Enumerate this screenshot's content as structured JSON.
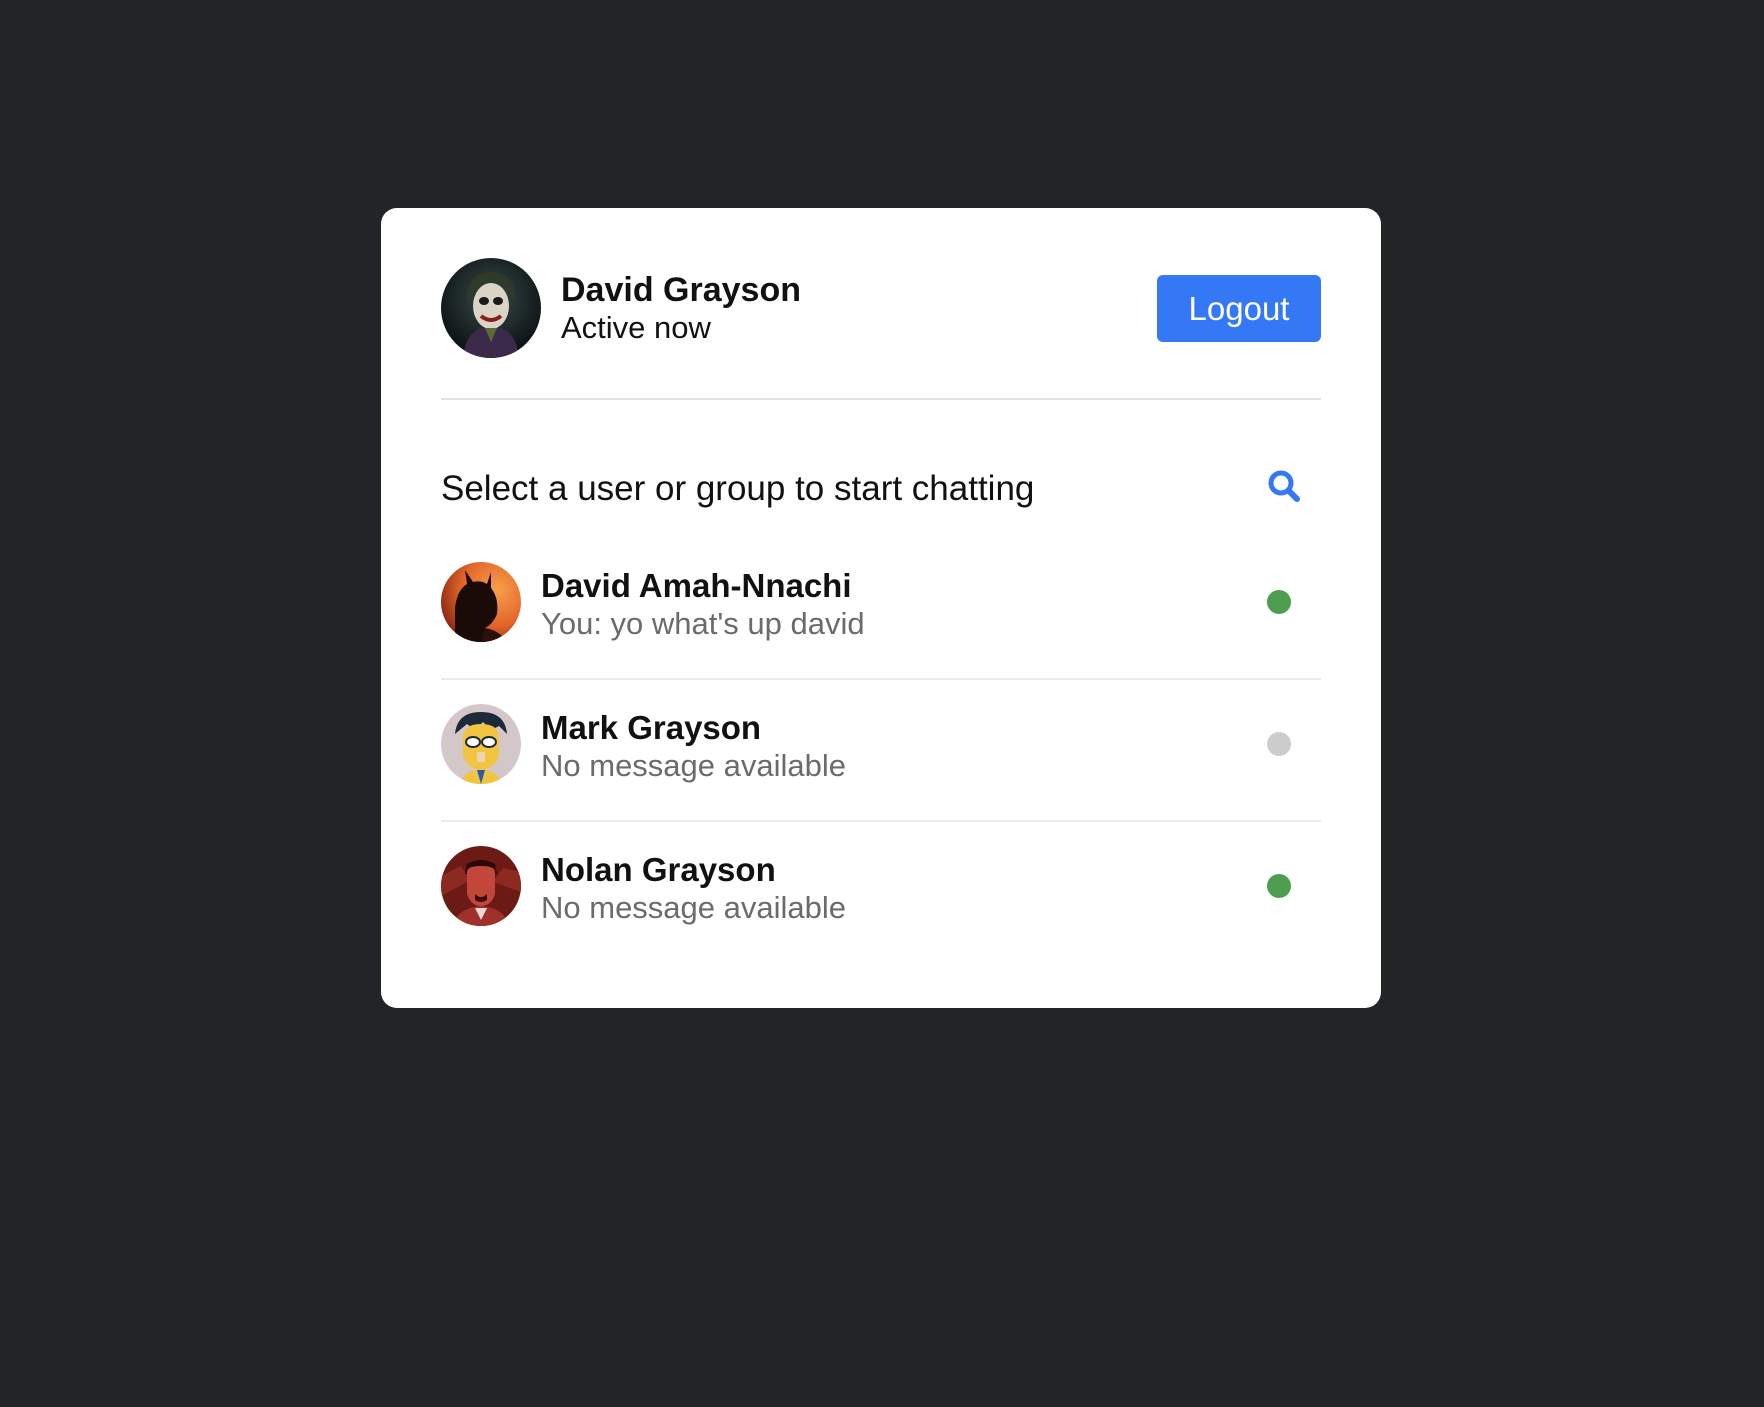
{
  "current_user": {
    "name": "David Grayson",
    "status": "Active now",
    "avatar_icon": "joker-avatar"
  },
  "header": {
    "logout_label": "Logout",
    "accent_color": "#3478f6"
  },
  "search": {
    "prompt": "Select a user or group to start chatting",
    "icon": "search-icon"
  },
  "users": [
    {
      "name": "David Amah-Nnachi",
      "last_message": "You: yo what's up david",
      "online": true,
      "status_color": "#4c9f4f",
      "avatar_icon": "batman-avatar"
    },
    {
      "name": "Mark Grayson",
      "last_message": "No message available",
      "online": false,
      "status_color": "#cccccc",
      "avatar_icon": "invincible-avatar"
    },
    {
      "name": "Nolan Grayson",
      "last_message": "No message available",
      "online": true,
      "status_color": "#4c9f4f",
      "avatar_icon": "omni-man-avatar"
    }
  ]
}
